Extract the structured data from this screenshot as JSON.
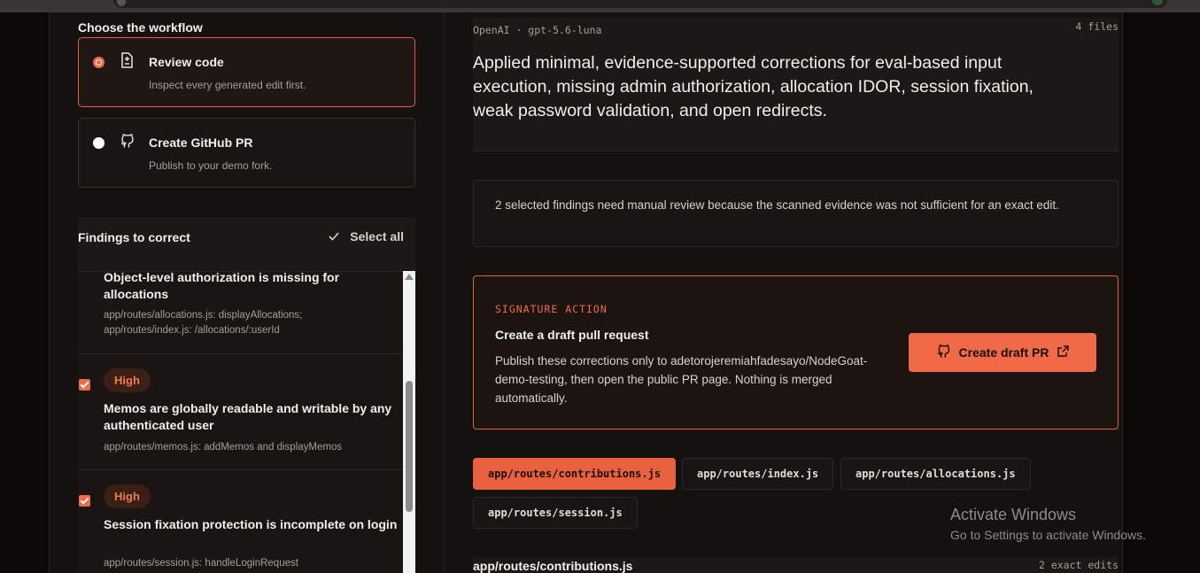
{
  "workflow": {
    "heading": "Choose the workflow",
    "options": [
      {
        "title": "Review code",
        "description": "Inspect every generated edit first.",
        "selected": true,
        "icon": "file-diff-icon"
      },
      {
        "title": "Create GitHub PR",
        "description": "Publish to your demo fork.",
        "selected": false,
        "icon": "github-icon"
      }
    ]
  },
  "findings": {
    "heading": "Findings to correct",
    "select_all_label": "Select all",
    "items": [
      {
        "title": "Object-level authorization is missing for allocations",
        "path": "app/routes/allocations.js: displayAllocations; app/routes/index.js: /allocations/:userId",
        "severity": "",
        "checked": true
      },
      {
        "title": "Memos are globally readable and writable by any authenticated user",
        "path": "app/routes/memos.js: addMemos and displayMemos",
        "severity": "High",
        "checked": true
      },
      {
        "title": "Session fixation protection is incomplete on login",
        "path": "app/routes/session.js: handleLoginRequest",
        "severity": "High",
        "checked": true
      }
    ]
  },
  "summary": {
    "model": "OpenAI · gpt-5.6-luna",
    "files_count": "4 files",
    "text": "Applied minimal, evidence-supported corrections for eval-based input execution, missing admin authorization, allocation IDOR, session fixation, weak password validation, and open redirects."
  },
  "notice": {
    "text": "2 selected findings need manual review because the scanned evidence was not sufficient for an exact edit."
  },
  "signature": {
    "eyebrow": "SIGNATURE ACTION",
    "title": "Create a draft pull request",
    "description": "Publish these corrections only to adetorojeremiahfadesayo/NodeGoat-demo-testing, then open the public PR page. Nothing is merged automatically.",
    "button_label": "Create draft PR"
  },
  "files": {
    "tabs": [
      "app/routes/contributions.js",
      "app/routes/index.js",
      "app/routes/allocations.js",
      "app/routes/session.js"
    ],
    "active_index": 0,
    "current_file": "app/routes/contributions.js",
    "current_edits": "2 exact edits"
  },
  "watermark": {
    "line1": "Activate Windows",
    "line2": "Go to Settings to activate Windows."
  },
  "colors": {
    "accent": "#e8613f",
    "background": "#0b0807",
    "panel": "#15110f",
    "badge_bg": "#3a1f14"
  }
}
